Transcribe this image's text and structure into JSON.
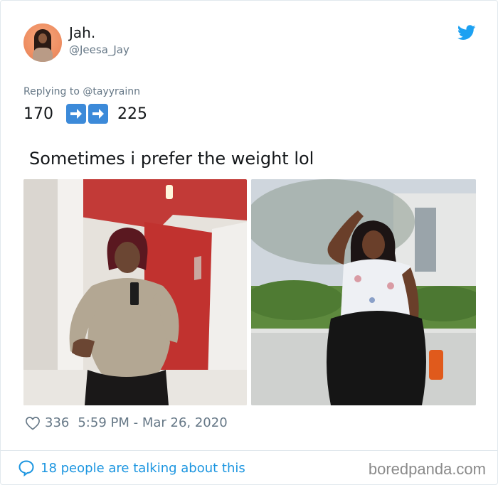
{
  "tweet": {
    "author_name": "Jah.",
    "author_handle": "@Jeesa_Jay",
    "replying_to": "Replying to @tayyrainn",
    "number_before": "170",
    "number_after": "225",
    "text": "Sometimes i prefer the weight lol",
    "likes": "336",
    "timestamp": "5:59 PM - Mar 26, 2020",
    "conversation": "18 people are talking about this"
  },
  "watermark": "boredpanda.com",
  "colors": {
    "twitter_blue": "#1da1f2",
    "link_blue": "#1b95e0",
    "arrow_blue": "#3c8ad9",
    "muted_gray": "#657786"
  },
  "icons": [
    "twitter-bird-icon",
    "right-arrow-icon",
    "heart-icon",
    "speech-bubble-icon"
  ]
}
